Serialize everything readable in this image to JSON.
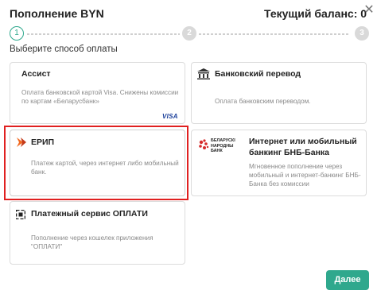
{
  "header": {
    "title": "Пополнение BYN",
    "balance": "Текущий баланс: 0",
    "close_icon": "close-icon"
  },
  "stepper": {
    "steps": [
      "1",
      "2",
      "3"
    ],
    "active_index": 0
  },
  "subtitle": "Выберите способ оплаты",
  "methods": {
    "assist": {
      "title": "Ассист",
      "description": "Оплата банковской картой Visa. Снижены комиссии по картам «Беларусбанк»",
      "badge": "VISA"
    },
    "bank_transfer": {
      "title": "Банковский перевод",
      "description": "Оплата банковским переводом.",
      "icon": "bank-building-icon"
    },
    "erip": {
      "title": "ЕРИП",
      "description": "Платеж картой, через интернет либо мобильный банк.",
      "icon": "erip-chevron-icon",
      "selected": true
    },
    "bnb": {
      "title": "Интернет или мобильный банкинг БНБ-Банка",
      "description": "Мгновенное пополнение через мобильный и интернет-банкинг БНБ-Банка без комиссии",
      "logo_text": "БЕЛАРУСКІ НАРОДНЫ БАНК",
      "icon": "bnb-bank-logo"
    },
    "oplati": {
      "title": "Платежный сервис ОПЛАТИ",
      "description": "Пополнение через кошелек приложения \"ОПЛАТИ\"",
      "icon": "oplati-square-icon"
    }
  },
  "footer": {
    "next_label": "Далее"
  },
  "colors": {
    "accent": "#2fa88d",
    "selection": "#e02020",
    "erip_orange": "#f26a21",
    "bnb_red": "#d62b2b",
    "visa_blue": "#1a3e9a"
  }
}
